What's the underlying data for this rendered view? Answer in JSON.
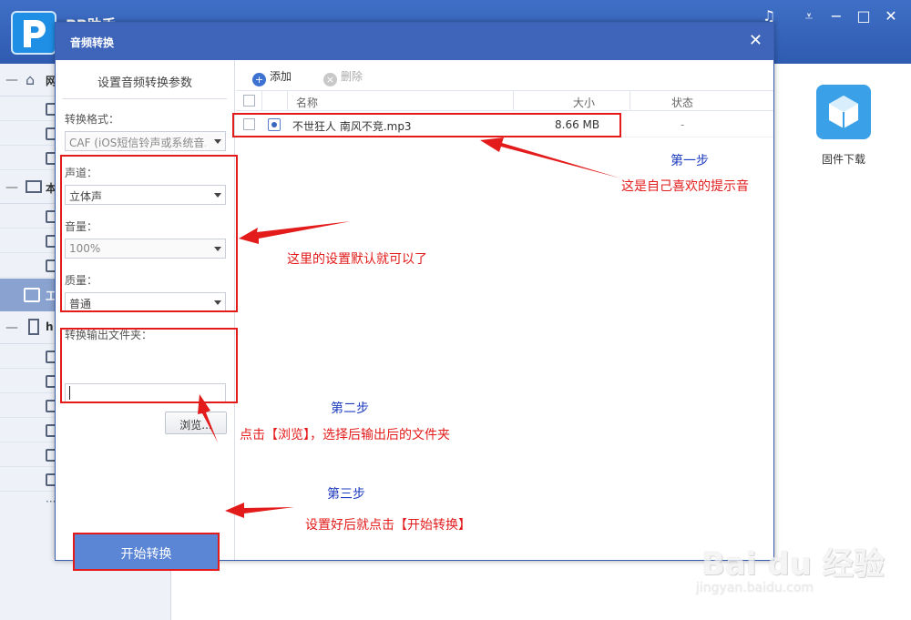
{
  "app": {
    "title": "PP助手",
    "sidebar": {
      "groups": [
        {
          "label": "网"
        },
        {
          "label": "本"
        },
        {
          "label": "工"
        },
        {
          "label": "h"
        }
      ]
    },
    "firmware_label": "固件下载"
  },
  "dialog": {
    "title": "音频转换",
    "close_symbol": "✕",
    "panel_title": "设置音频转换参数",
    "format": {
      "label": "转换格式：",
      "value": "CAF (iOS短信铃声或系统音..."
    },
    "channel": {
      "label": "声道：",
      "value": "立体声"
    },
    "volume": {
      "label": "音量：",
      "value": "100%"
    },
    "quality": {
      "label": "质量：",
      "value": "普通"
    },
    "output": {
      "label": "转换输出文件夹：",
      "value": ""
    },
    "browse_label": "浏览...",
    "start_label": "开始转换",
    "toolbar": {
      "add_label": "添加",
      "delete_label": "删除"
    },
    "table": {
      "headers": {
        "name": "名称",
        "size": "大小",
        "status": "状态"
      },
      "rows": [
        {
          "name": "不世狂人 南风不竞.mp3",
          "size": "8.66 MB",
          "status": "-"
        }
      ]
    }
  },
  "annotations": {
    "step1_title": "第一步",
    "step1_text": "这是自己喜欢的提示音",
    "settings_text": "这里的设置默认就可以了",
    "step2_title": "第二步",
    "step2_text": "点击【浏览】，选择后输出后的文件夹",
    "step3_title": "第三步",
    "step3_text": "设置好后就点击【开始转换】"
  },
  "watermark": {
    "main": "Bai du 经验",
    "url": "jingyan.baidu.com"
  },
  "colors": {
    "accent": "#3e65ba",
    "annotation_red": "#e31b1b",
    "annotation_blue": "#1d3bbf",
    "start_button": "#5b86d6"
  }
}
